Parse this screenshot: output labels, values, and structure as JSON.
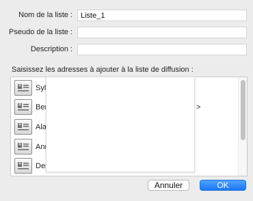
{
  "form": {
    "list_name_label": "Nom de la liste :",
    "list_name_value": "Liste_1",
    "alias_label": "Pseudo de la liste :",
    "alias_value": "",
    "description_label": "Description :",
    "description_value": ""
  },
  "instruction": "Saisissez les adresses à ajouter à la liste de diffusion :",
  "address_list": {
    "items": [
      {
        "name": "Syl",
        "trail": "",
        "icon": "contact-card-icon"
      },
      {
        "name": "Ber",
        "trail": ">",
        "icon": "contact-card-icon"
      },
      {
        "name": "Ala",
        "trail": "",
        "icon": "contact-card-icon"
      },
      {
        "name": "Ann",
        "trail": "",
        "icon": "contact-card-icon"
      },
      {
        "name": "Der",
        "trail": "",
        "icon": "contact-card-icon"
      }
    ]
  },
  "buttons": {
    "cancel_label": "Annuler",
    "ok_label": "OK"
  },
  "colors": {
    "window_bg": "#ececec",
    "accent": "#1a76f2"
  }
}
